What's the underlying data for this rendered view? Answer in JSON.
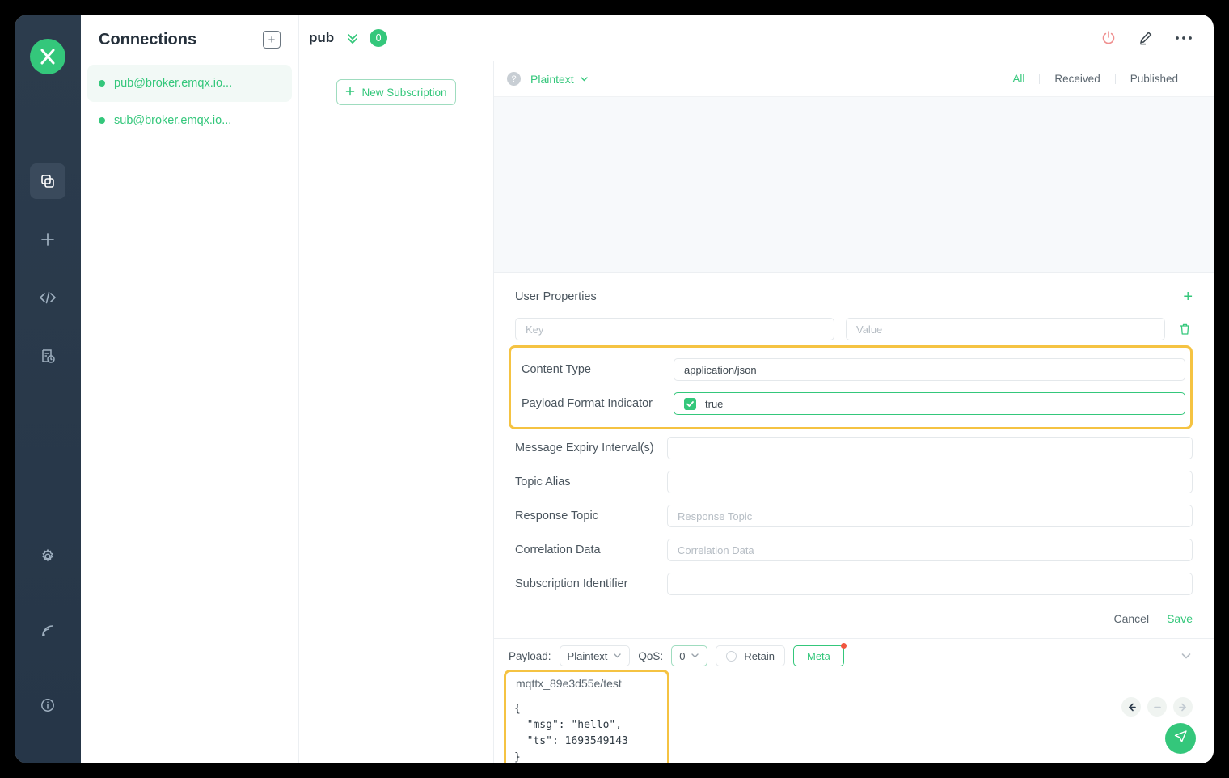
{
  "rail": {
    "logo": "mqttx-logo",
    "items": [
      {
        "name": "connections",
        "icon": "copy-icon",
        "active": true
      },
      {
        "name": "new-connection",
        "icon": "plus-icon",
        "active": false
      },
      {
        "name": "scripts",
        "icon": "code-icon",
        "active": false
      },
      {
        "name": "log",
        "icon": "log-icon",
        "active": false
      }
    ],
    "bottom": [
      {
        "name": "settings",
        "icon": "gear-icon"
      },
      {
        "name": "broker",
        "icon": "signal-icon"
      },
      {
        "name": "about",
        "icon": "info-icon"
      }
    ]
  },
  "sidebar": {
    "title": "Connections",
    "add_label": "+",
    "items": [
      {
        "label": "pub@broker.emqx.io...",
        "selected": true,
        "status": "connected"
      },
      {
        "label": "sub@broker.emqx.io...",
        "selected": false,
        "status": "connected"
      }
    ]
  },
  "topbar": {
    "name": "pub",
    "badge": "0",
    "icons": [
      "power-icon",
      "edit-icon",
      "more-icon"
    ]
  },
  "subscriptions": {
    "new_label": "New Subscription"
  },
  "messages": {
    "format": "Plaintext",
    "help": "?",
    "filters": [
      {
        "label": "All",
        "active": true
      },
      {
        "label": "Received",
        "active": false
      },
      {
        "label": "Published",
        "active": false
      }
    ]
  },
  "properties": {
    "title": "User Properties",
    "add": "+",
    "key_placeholder": "Key",
    "value_placeholder": "Value",
    "key_value": "",
    "value_value": "",
    "fields": [
      {
        "label": "Content Type",
        "value": "application/json",
        "placeholder": "",
        "highlight": true,
        "checkbox": false
      },
      {
        "label": "Payload Format Indicator",
        "value": "true",
        "placeholder": "",
        "highlight": true,
        "checkbox": true
      },
      {
        "label": "Message Expiry Interval(s)",
        "value": "",
        "placeholder": "",
        "highlight": false,
        "checkbox": false
      },
      {
        "label": "Topic Alias",
        "value": "",
        "placeholder": "",
        "highlight": false,
        "checkbox": false
      },
      {
        "label": "Response Topic",
        "value": "",
        "placeholder": "Response Topic",
        "highlight": false,
        "checkbox": false
      },
      {
        "label": "Correlation Data",
        "value": "",
        "placeholder": "Correlation Data",
        "highlight": false,
        "checkbox": false
      },
      {
        "label": "Subscription Identifier",
        "value": "",
        "placeholder": "",
        "highlight": false,
        "checkbox": false
      }
    ],
    "cancel_label": "Cancel",
    "save_label": "Save"
  },
  "composer": {
    "payload_label": "Payload:",
    "payload_format": "Plaintext",
    "qos_label": "QoS:",
    "qos_value": "0",
    "retain_label": "Retain",
    "meta_label": "Meta",
    "topic": "mqttx_89e3d55e/test",
    "payload_body": "{\n  \"msg\": \"hello\",\n  \"ts\": 1693549143\n}"
  },
  "colors": {
    "accent": "#34c77b",
    "highlight": "#f5c342",
    "danger": "#f0563f",
    "rail": "#2b3a4a"
  }
}
